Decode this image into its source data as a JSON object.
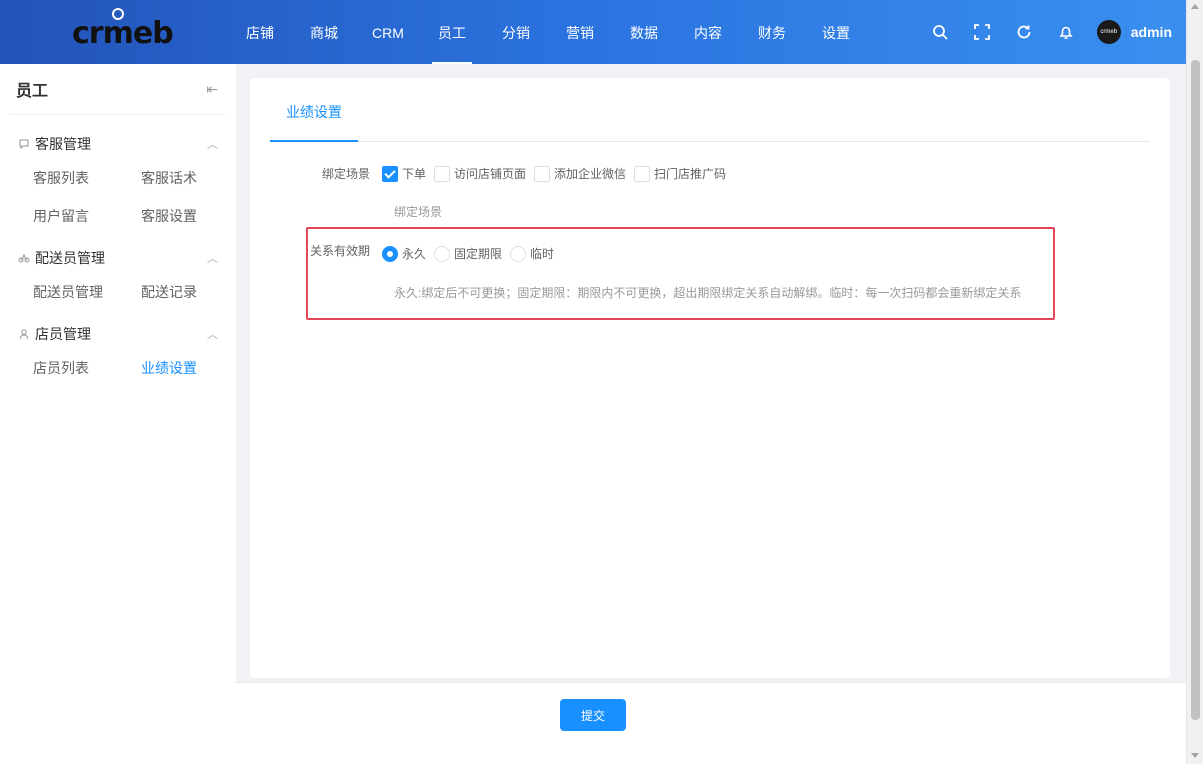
{
  "header": {
    "nav": [
      "店铺",
      "商城",
      "CRM",
      "员工",
      "分销",
      "营销",
      "数据",
      "内容",
      "财务",
      "设置"
    ],
    "active_nav_index": 3,
    "icons": [
      "search-icon",
      "fullscreen-icon",
      "refresh-icon",
      "bell-icon"
    ],
    "username": "admin",
    "avatar_text": "crmeb",
    "accent": "#2b74e0"
  },
  "sidebar": {
    "title": "员工",
    "groups": [
      {
        "label": "客服管理",
        "icon": "chat-icon",
        "items": [
          "客服列表",
          "客服话术",
          "用户留言",
          "客服设置"
        ]
      },
      {
        "label": "配送员管理",
        "icon": "bike-icon",
        "items": [
          "配送员管理",
          "配送记录"
        ]
      },
      {
        "label": "店员管理",
        "icon": "person-icon",
        "items": [
          "店员列表",
          "业绩设置"
        ]
      }
    ],
    "active_item": "业绩设置"
  },
  "main": {
    "tab": "业绩设置",
    "bind_scene": {
      "label": "绑定场景",
      "options": [
        {
          "label": "下单",
          "checked": true
        },
        {
          "label": "访问店铺页面",
          "checked": false
        },
        {
          "label": "添加企业微信",
          "checked": false
        },
        {
          "label": "扫门店推广码",
          "checked": false
        }
      ],
      "hint": "绑定场景"
    },
    "validity": {
      "label": "关系有效期",
      "options": [
        {
          "label": "永久",
          "checked": true
        },
        {
          "label": "固定期限",
          "checked": false
        },
        {
          "label": "临时",
          "checked": false
        }
      ],
      "hint": "永久:绑定后不可更换；固定期限：期限内不可更换，超出期限绑定关系自动解绑。临时：每一次扫码都会重新绑定关系"
    },
    "highlight_color": "#e8445a"
  },
  "footer": {
    "submit_label": "提交"
  }
}
